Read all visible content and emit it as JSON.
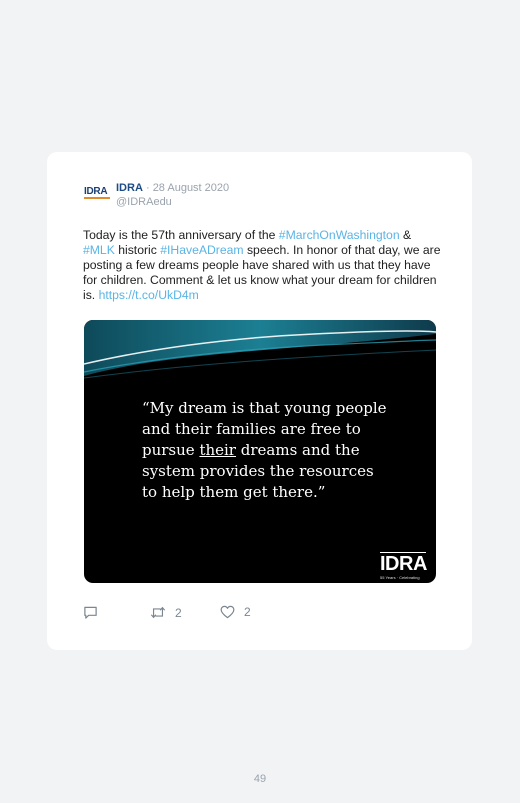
{
  "tweet": {
    "author_name": "IDRA",
    "separator": "·",
    "date": "28 August 2020",
    "handle": "@IDRAedu",
    "avatar_text": "IDRA",
    "text": {
      "part1": "Today is the 57th anniversary of the ",
      "tag1": "#MarchOnWashington",
      "part2": " & ",
      "tag2": "#MLK",
      "part3": " historic ",
      "tag3": "#IHaveADream",
      "part4": " speech. In honor of that day, we are posting a few dreams people have shared with us that they have for children. Comment & let us know what your dream for children is. ",
      "link": "https://t.co/UkD4m"
    },
    "media": {
      "quote_line1": "“My dream is that young people",
      "quote_line2": "and their families are free to",
      "quote_line3a": "pursue ",
      "quote_line3u": "their",
      "quote_line3b": " dreams and the",
      "quote_line4": "system provides the resources",
      "quote_line5": "to help them get there.”",
      "brand_name": "IDRA",
      "brand_sub": "55 Years · Celebrating"
    },
    "actions": {
      "reply_icon": "reply-icon",
      "retweet_icon": "retweet-icon",
      "retweet_count": "2",
      "like_icon": "heart-icon",
      "like_count": "2"
    },
    "colors": {
      "hashtag": "#5ab4e5",
      "name": "#1d4c84",
      "muted": "#9aa3ad"
    }
  },
  "page": {
    "number": "49"
  }
}
